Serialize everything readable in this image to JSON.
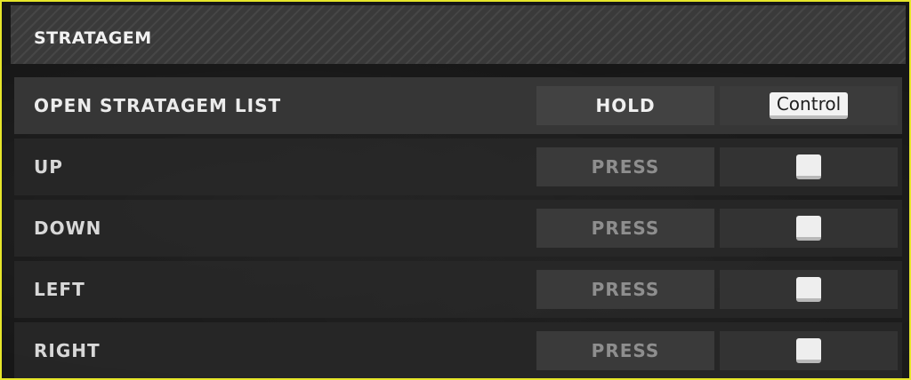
{
  "section": {
    "title": "STRATAGEM"
  },
  "rows": [
    {
      "label": "OPEN STRATAGEM LIST",
      "action": "HOLD",
      "key": "Control",
      "active": true
    },
    {
      "label": "UP",
      "action": "PRESS",
      "key": "",
      "key_icon": "blank-keycap-icon"
    },
    {
      "label": "DOWN",
      "action": "PRESS",
      "key": "",
      "key_icon": "blank-keycap-icon"
    },
    {
      "label": "LEFT",
      "action": "PRESS",
      "key": "",
      "key_icon": "blank-keycap-icon"
    },
    {
      "label": "RIGHT",
      "action": "PRESS",
      "key": "",
      "key_icon": "blank-keycap-icon"
    }
  ],
  "colors": {
    "frame_border": "#e6e62a",
    "keycap": "#f3f3f3"
  }
}
